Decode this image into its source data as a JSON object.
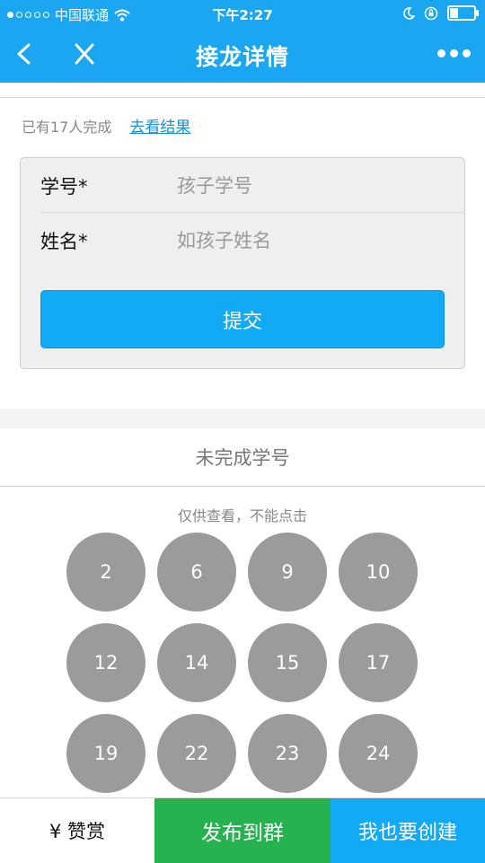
{
  "status_bar": {
    "carrier": "中国联通",
    "time": "下午2:27"
  },
  "navbar": {
    "title": "接龙详情"
  },
  "info": {
    "completed_text": "已有17人完成",
    "results_link": "去看结果"
  },
  "form": {
    "student_id_label": "学号*",
    "student_id_placeholder": "孩子学号",
    "name_label": "姓名*",
    "name_placeholder": "如孩子姓名",
    "submit_label": "提交"
  },
  "unfinished": {
    "title": "未完成学号",
    "hint": "仅供查看，不能点击",
    "numbers": [
      "2",
      "6",
      "9",
      "10",
      "12",
      "14",
      "15",
      "17",
      "19",
      "22",
      "23",
      "24"
    ]
  },
  "bottom_bar": {
    "reward_label": "¥ 赞赏",
    "publish_label": "发布到群",
    "create_label": "我也要创建"
  },
  "colors": {
    "brand_blue": "#1aa6f0",
    "publish_green": "#25b24f",
    "circle_gray": "#9b9b9b"
  }
}
